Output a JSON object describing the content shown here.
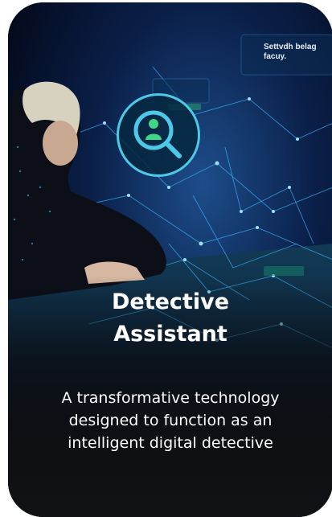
{
  "card": {
    "title_line1": "Detective",
    "title_line2": "Assistant",
    "description": "A transformative technology designed to function as an intelligent digital detective",
    "icon": "detective-search-icon"
  },
  "background": {
    "screen_label_line1": "Settvdh belag",
    "screen_label_line2": "facuy."
  },
  "colors": {
    "accent": "#4cc9e8",
    "icon_green": "#3fd68a",
    "card_bg": "#040a1c"
  }
}
